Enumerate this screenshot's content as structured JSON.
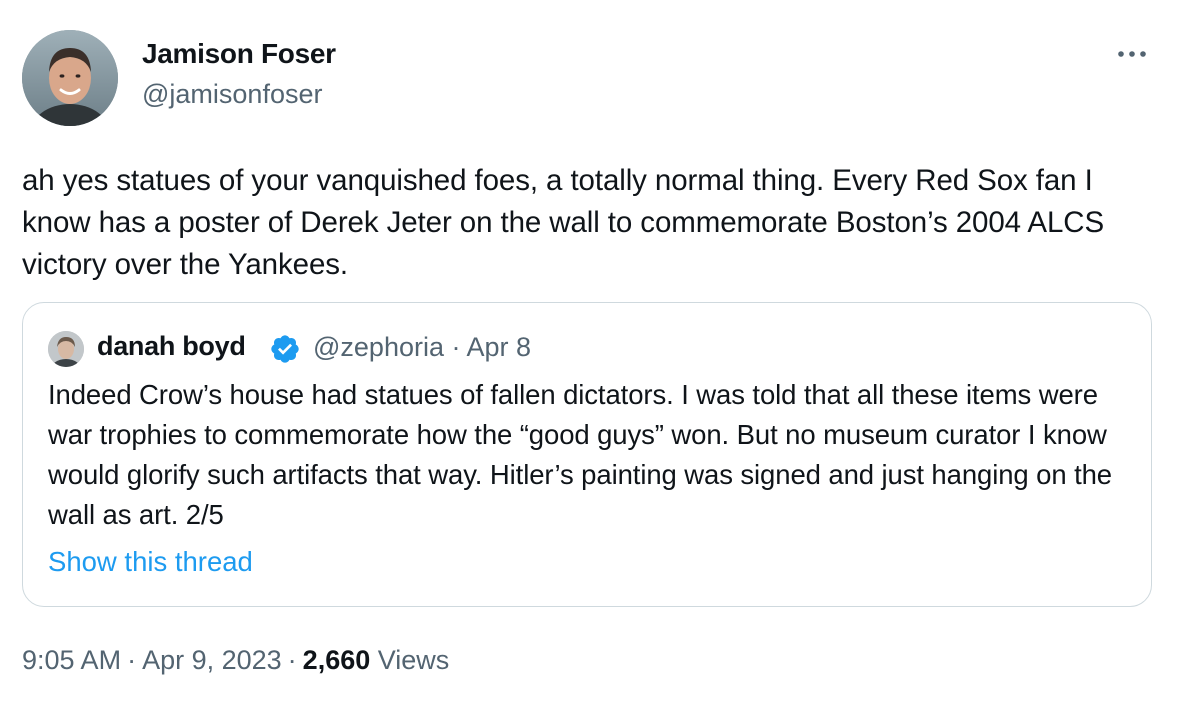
{
  "author": {
    "name": "Jamison Foser",
    "handle": "@jamisonfoser",
    "avatar_icon": "profile-photo"
  },
  "tweet": {
    "text": "ah yes statues of your vanquished foes, a totally normal thing. Every Red Sox fan I know has a poster of Derek Jeter on the wall to commemorate Boston’s 2004 ALCS victory over the Yankees."
  },
  "quote": {
    "name": "danah boyd",
    "handle": "@zephoria",
    "separator": "·",
    "date": "Apr 8",
    "verified_icon": "verified-badge-icon",
    "text": "Indeed Crow’s house had statues of fallen dictators. I was told that all these items were war trophies to commemorate how the “good guys” won. But no museum curator I know would glorify such artifacts that way. Hitler’s painting was signed and just hanging on the wall as art. 2/5",
    "show_thread_label": "Show this thread"
  },
  "footer": {
    "time": "9:05 AM",
    "separator": "·",
    "date": "Apr 9, 2023",
    "views_count": "2,660",
    "views_label": "Views"
  },
  "colors": {
    "text_primary": "#0f1419",
    "text_secondary": "#536471",
    "link": "#1d9bf0",
    "border": "#cfd9de",
    "verified": "#1d9bf0"
  }
}
